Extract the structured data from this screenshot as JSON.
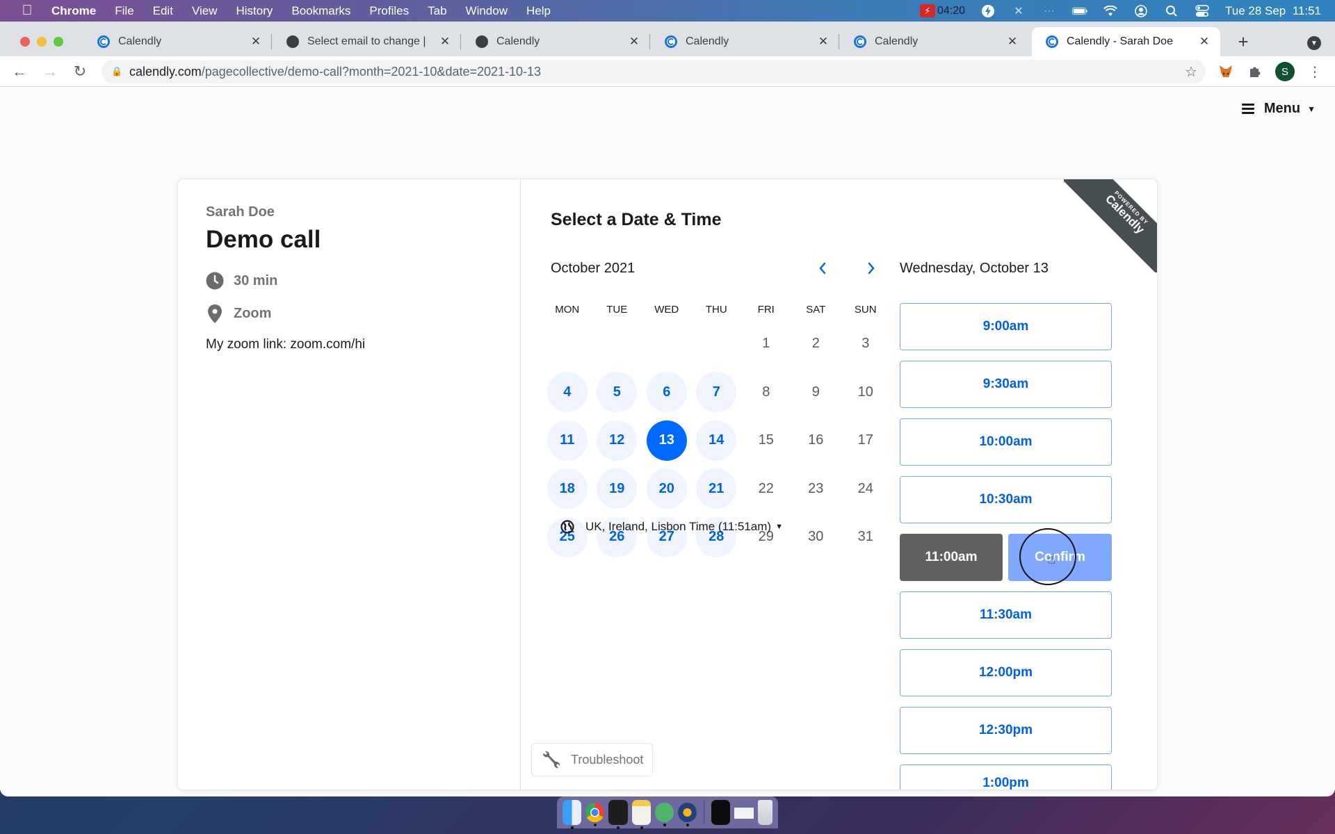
{
  "menubar": {
    "app_name": "Chrome",
    "items": [
      "File",
      "Edit",
      "View",
      "History",
      "Bookmarks",
      "Profiles",
      "Tab",
      "Window",
      "Help"
    ],
    "recording_time": "04:20",
    "datetime": "Tue 28 Sep  11:51"
  },
  "browser": {
    "tabs": [
      {
        "title": "Calendly",
        "icon": "calendly-icon",
        "active": false
      },
      {
        "title": "Select email to change | ",
        "icon": "globe-icon",
        "active": false
      },
      {
        "title": "Calendly",
        "icon": "globe-icon",
        "active": false
      },
      {
        "title": "Calendly",
        "icon": "calendly-icon",
        "active": false
      },
      {
        "title": "Calendly",
        "icon": "calendly-icon",
        "active": false
      },
      {
        "title": "Calendly - Sarah Doe",
        "icon": "calendly-icon",
        "active": true
      }
    ],
    "new_tab_label": "+",
    "url_host": "calendly.com",
    "url_path": "/pagecollective/demo-call?month=2021-10&date=2021-10-13",
    "profile_initial": "S"
  },
  "page": {
    "menu_label": "Menu",
    "host_name": "Sarah Doe",
    "event_title": "Demo call",
    "duration": "30 min",
    "location": "Zoom",
    "description": "My zoom link: zoom.com/hi",
    "section_title": "Select a Date & Time",
    "month_label": "October 2021",
    "weekdays": [
      "MON",
      "TUE",
      "WED",
      "THU",
      "FRI",
      "SAT",
      "SUN"
    ],
    "calendar": {
      "leading_blanks": 4,
      "days": [
        {
          "n": "1",
          "state": "unavailable"
        },
        {
          "n": "2",
          "state": "unavailable"
        },
        {
          "n": "3",
          "state": "unavailable"
        },
        {
          "n": "4",
          "state": "available"
        },
        {
          "n": "5",
          "state": "available"
        },
        {
          "n": "6",
          "state": "available"
        },
        {
          "n": "7",
          "state": "available"
        },
        {
          "n": "8",
          "state": "unavailable"
        },
        {
          "n": "9",
          "state": "unavailable"
        },
        {
          "n": "10",
          "state": "unavailable"
        },
        {
          "n": "11",
          "state": "available"
        },
        {
          "n": "12",
          "state": "available"
        },
        {
          "n": "13",
          "state": "selected"
        },
        {
          "n": "14",
          "state": "available"
        },
        {
          "n": "15",
          "state": "unavailable"
        },
        {
          "n": "16",
          "state": "unavailable"
        },
        {
          "n": "17",
          "state": "unavailable"
        },
        {
          "n": "18",
          "state": "available"
        },
        {
          "n": "19",
          "state": "available"
        },
        {
          "n": "20",
          "state": "available"
        },
        {
          "n": "21",
          "state": "available"
        },
        {
          "n": "22",
          "state": "unavailable"
        },
        {
          "n": "23",
          "state": "unavailable"
        },
        {
          "n": "24",
          "state": "unavailable"
        },
        {
          "n": "25",
          "state": "available"
        },
        {
          "n": "26",
          "state": "available"
        },
        {
          "n": "27",
          "state": "available"
        },
        {
          "n": "28",
          "state": "available"
        },
        {
          "n": "29",
          "state": "unavailable"
        },
        {
          "n": "30",
          "state": "unavailable"
        },
        {
          "n": "31",
          "state": "unavailable"
        }
      ]
    },
    "timezone": "UK, Ireland, Lisbon Time (11:51am)",
    "troubleshoot_label": "Troubleshoot",
    "selected_date": "Wednesday, October 13",
    "time_slots_before": [
      "9:00am",
      "9:30am",
      "10:00am",
      "10:30am"
    ],
    "selected_slot": "11:00am",
    "confirm_label": "Confirm",
    "time_slots_after": [
      "11:30am",
      "12:00pm",
      "12:30pm"
    ],
    "time_slot_partial": "1:00pm",
    "ribbon": {
      "top": "POWERED BY",
      "brand": "Calendly"
    }
  },
  "colors": {
    "accent": "#0069ff",
    "available_bg": "#f0f4ff",
    "confirm": "#80a8ff",
    "selected_slot": "#616161",
    "ribbon": "#484f52"
  },
  "dock": {
    "apps": [
      "Finder",
      "Chrome",
      "Terminal",
      "Notes",
      "Atom",
      "Reeder"
    ],
    "others": [
      "Screen recording",
      "Preview window",
      "Trash"
    ]
  }
}
